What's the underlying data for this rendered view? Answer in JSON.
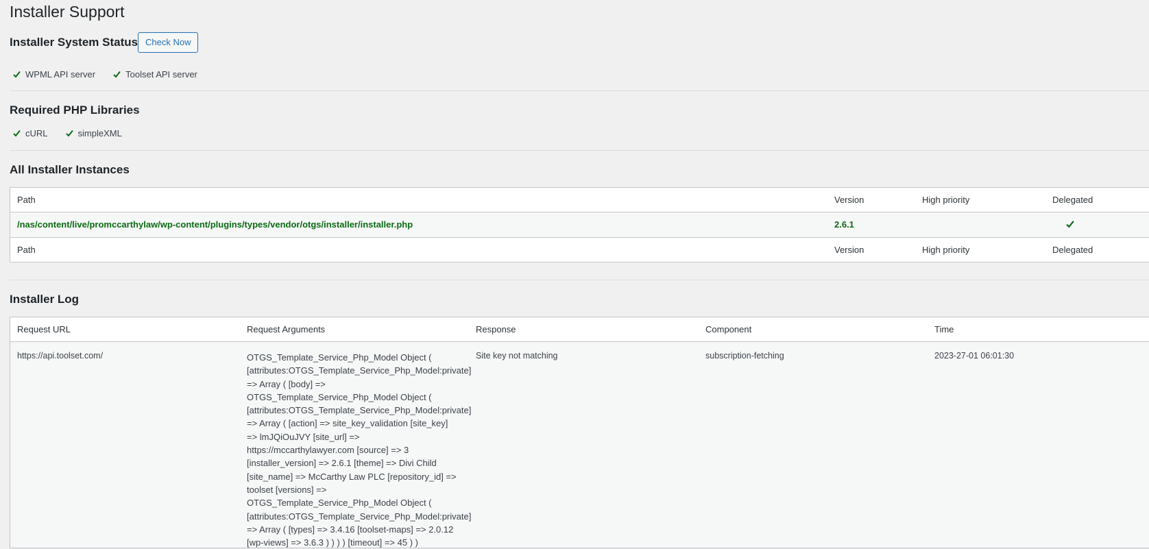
{
  "page": {
    "title": "Installer Support"
  },
  "system_status": {
    "title": "Installer System Status",
    "check_button": "Check Now",
    "items": [
      {
        "label": "WPML API server",
        "icon": "check-icon"
      },
      {
        "label": "Toolset API server",
        "icon": "check-icon"
      }
    ]
  },
  "php_libraries": {
    "title": "Required PHP Libraries",
    "items": [
      {
        "label": "cURL",
        "icon": "check-icon"
      },
      {
        "label": "simpleXML",
        "icon": "check-icon"
      }
    ]
  },
  "instances": {
    "title": "All Installer Instances",
    "columns": {
      "path": "Path",
      "version": "Version",
      "high_priority": "High priority",
      "delegated": "Delegated"
    },
    "rows": [
      {
        "path": "/nas/content/live/promccarthylaw/wp-content/plugins/types/vendor/otgs/installer/installer.php",
        "version": "2.6.1",
        "high_priority": "",
        "delegated_icon": "check-icon"
      }
    ]
  },
  "log": {
    "title": "Installer Log",
    "columns": {
      "request_url": "Request URL",
      "request_arguments": "Request Arguments",
      "response": "Response",
      "component": "Component",
      "time": "Time"
    },
    "rows": [
      {
        "request_url": "https://api.toolset.com/",
        "request_arguments": "OTGS_Template_Service_Php_Model Object ( [attributes:OTGS_Template_Service_Php_Model:private] => Array ( [body] => OTGS_Template_Service_Php_Model Object ( [attributes:OTGS_Template_Service_Php_Model:private] => Array ( [action] => site_key_validation [site_key] => lmJQiOuJVY [site_url] => https://mccarthylawyer.com [source] => 3 [installer_version] => 2.6.1 [theme] => Divi Child [site_name] => McCarthy Law PLC [repository_id] => toolset [versions] => OTGS_Template_Service_Php_Model Object ( [attributes:OTGS_Template_Service_Php_Model:private] => Array ( [types] => 3.4.16 [toolset-maps] => 2.0.12 [wp-views] => 3.6.3 ) ) ) ) [timeout] => 45 ) )",
        "response": "Site key not matching",
        "component": "subscription-fetching",
        "time": "2023-27-01 06:01:30"
      }
    ]
  },
  "colors": {
    "check": "#0a6b13",
    "link_blue": "#2271b1",
    "background": "#f0f0f1"
  }
}
